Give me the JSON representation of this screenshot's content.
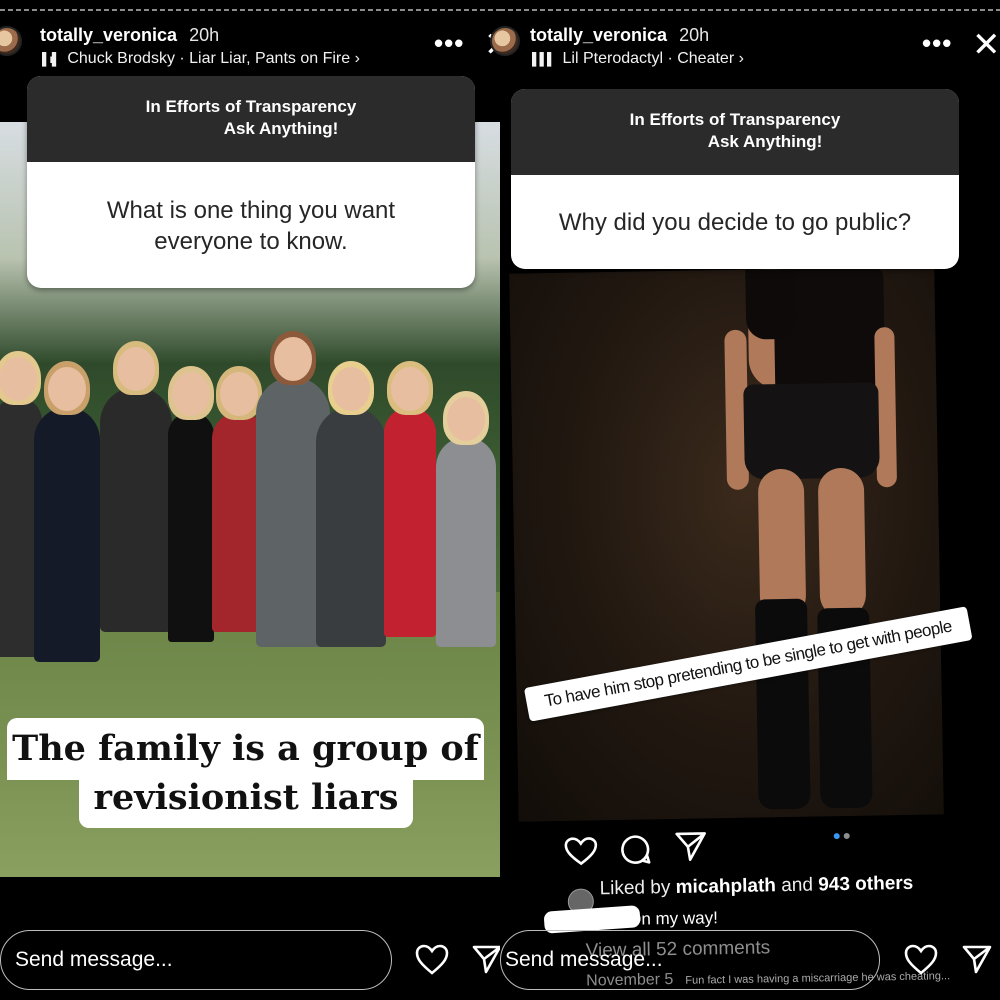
{
  "left_story": {
    "username": "totally_veronica",
    "time": "20h",
    "music": "Chuck Brodsky · Liar Liar, Pants on Fire",
    "more_label": "•••",
    "question": {
      "header_line1": "In Efforts of Transparency",
      "header_line2": "Ask Anything!",
      "body": "What is one thing you want everyone to know."
    },
    "overlay_line1": "The family is a group of",
    "overlay_line2": "revisionist liars",
    "send_placeholder": "Send message..."
  },
  "right_story": {
    "username": "totally_veronica",
    "time": "20h",
    "music": "Lil Pterodactyl · Cheater",
    "more_label": "•••",
    "question": {
      "header_line1": "In Efforts of Transparency",
      "header_line2": "Ask Anything!",
      "body": "Why did you decide to go public?"
    },
    "caption": "To have him stop pretending to be single to get with people",
    "post": {
      "liked_prefix": "Liked by",
      "liked_user": "micahplath",
      "liked_and": "and",
      "liked_others": "943 others",
      "comment": "On my way!",
      "view_all": "View all 52 comments",
      "date": "November 5",
      "caption_note": "Fun fact I was having a miscarriage he was cheating..."
    },
    "send_placeholder": "Send message..."
  },
  "colors": {
    "background": "#000000",
    "question_header": "#2b2b2b",
    "question_body_text": "#262626",
    "muted_text": "#8e8e8e"
  },
  "icons": {
    "like": "heart-icon",
    "share": "send-icon",
    "comment": "comment-icon",
    "close": "close-icon",
    "music": "music-bars-icon"
  }
}
